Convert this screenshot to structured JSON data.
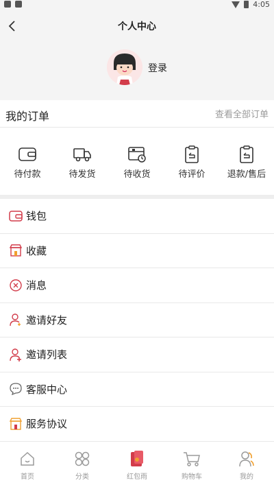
{
  "status_bar": {
    "time": "4:05"
  },
  "header": {
    "title": "个人中心",
    "login_label": "登录"
  },
  "orders": {
    "title": "我的订单",
    "view_all": "查看全部订单",
    "items": [
      {
        "label": "待付款",
        "icon": "wallet-icon"
      },
      {
        "label": "待发货",
        "icon": "delivery-truck-icon"
      },
      {
        "label": "待收货",
        "icon": "package-clock-icon"
      },
      {
        "label": "待评价",
        "icon": "clipboard-review-icon"
      },
      {
        "label": "退款/售后",
        "icon": "clipboard-return-icon"
      }
    ]
  },
  "menu": [
    {
      "label": "钱包",
      "icon": "wallet-icon"
    },
    {
      "label": "收藏",
      "icon": "store-icon"
    },
    {
      "label": "消息",
      "icon": "message-circle-icon"
    },
    {
      "label": "邀请好友",
      "icon": "user-add-icon"
    },
    {
      "label": "邀请列表",
      "icon": "user-plus-icon"
    },
    {
      "label": "客服中心",
      "icon": "chat-bubble-icon"
    },
    {
      "label": "服务协议",
      "icon": "store-agreement-icon"
    }
  ],
  "tabbar": [
    {
      "label": "首页",
      "icon": "home-icon"
    },
    {
      "label": "分类",
      "icon": "category-icon"
    },
    {
      "label": "红包雨",
      "icon": "red-packet-icon"
    },
    {
      "label": "购物车",
      "icon": "cart-icon"
    },
    {
      "label": "我的",
      "icon": "profile-icon"
    }
  ],
  "colors": {
    "accent": "#d23c4a",
    "header_bg": "#f4f4f4",
    "muted": "#9a9a9a",
    "orange": "#f0a030"
  }
}
